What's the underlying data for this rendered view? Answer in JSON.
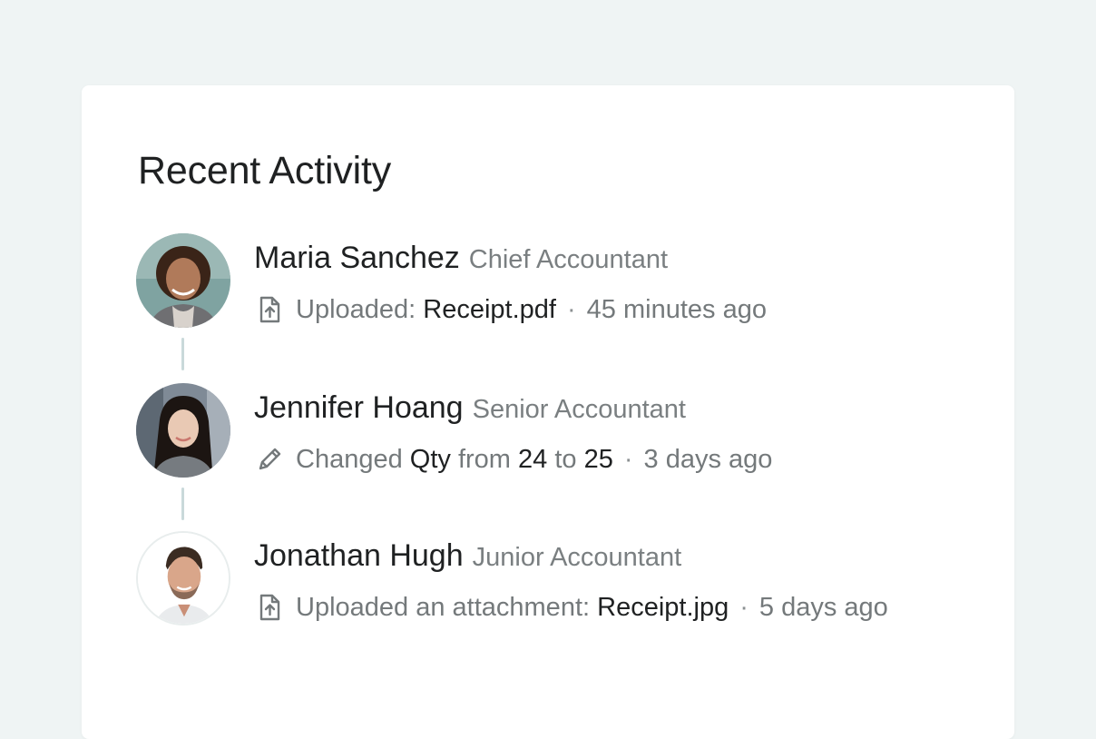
{
  "panel": {
    "title": "Recent Activity"
  },
  "activities": [
    {
      "name": "Maria Sanchez",
      "role": "Chief Accountant",
      "icon": "file-upload-icon",
      "action_prefix": "Uploaded: ",
      "file": "Receipt.pdf",
      "time": "45 minutes ago"
    },
    {
      "name": "Jennifer Hoang",
      "role": "Senior Accountant",
      "icon": "pencil-icon",
      "action_prefix": "Changed ",
      "field": "Qty",
      "from_word": " from ",
      "from_value": "24",
      "to_word": " to ",
      "to_value": "25",
      "time": "3 days ago"
    },
    {
      "name": "Jonathan Hugh",
      "role": "Junior Accountant",
      "icon": "file-upload-icon",
      "action_prefix": "Uploaded an attachment: ",
      "file": "Receipt.jpg",
      "time": "5 days ago"
    }
  ],
  "separator": "·",
  "colors": {
    "background": "#eff4f4",
    "card": "#ffffff",
    "text_primary": "#1f2122",
    "text_secondary": "#7a7f81",
    "connector": "#c9d9da"
  }
}
